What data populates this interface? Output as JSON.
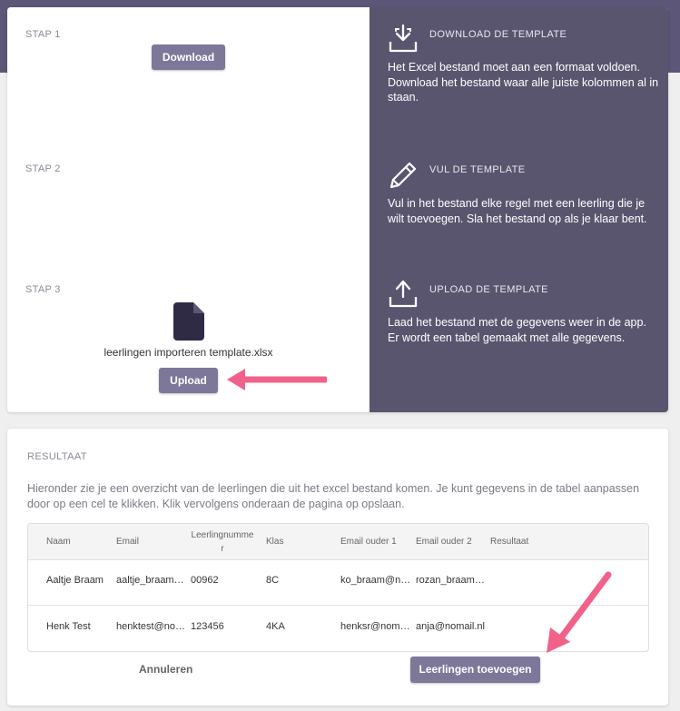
{
  "steps": [
    {
      "label": "STAP 1",
      "button": "Download"
    },
    {
      "label": "STAP 2"
    },
    {
      "label": "STAP 3",
      "file_name": "leerlingen importeren template.xlsx",
      "button": "Upload"
    }
  ],
  "info": [
    {
      "icon": "download-tray-icon",
      "title": "DOWNLOAD DE TEMPLATE",
      "text": "Het Excel bestand moet aan een formaat voldoen. Download het bestand waar alle juiste kolommen al in staan."
    },
    {
      "icon": "pencil-icon",
      "title": "VUL DE TEMPLATE",
      "text": "Vul in het bestand elke regel met een leerling die je wilt toevoegen. Sla het bestand op als je klaar bent."
    },
    {
      "icon": "upload-tray-icon",
      "title": "UPLOAD DE TEMPLATE",
      "text": "Laad het bestand met de gegevens weer in de app. Er wordt een tabel gemaakt met alle gegevens."
    }
  ],
  "result": {
    "title": "RESULTAAT",
    "description": "Hieronder zie je een overzicht van de leerlingen die uit het excel bestand komen. Je kunt gegevens in de tabel aanpassen door op een cel te klikken. Klik vervolgens onderaan de pagina op opslaan.",
    "columns": [
      "Naam",
      "Email",
      "Leerlingnummer",
      "Klas",
      "Email ouder 1",
      "Email ouder 2",
      "Resultaat"
    ],
    "rows": [
      [
        "Aaltje Braam",
        "aaltje_braam…",
        "00962",
        "8C",
        "ko_braam@n…",
        "rozan_braam…",
        ""
      ],
      [
        "Henk Test",
        "henktest@no…",
        "123456",
        "4KA",
        "henksr@nom…",
        "anja@nomail.nl",
        ""
      ]
    ],
    "cancel_label": "Annuleren",
    "add_label": "Leerlingen toevoegen"
  },
  "colors": {
    "accent": "#7d7799",
    "panel": "#5a556e",
    "arrow": "#f0628a"
  }
}
